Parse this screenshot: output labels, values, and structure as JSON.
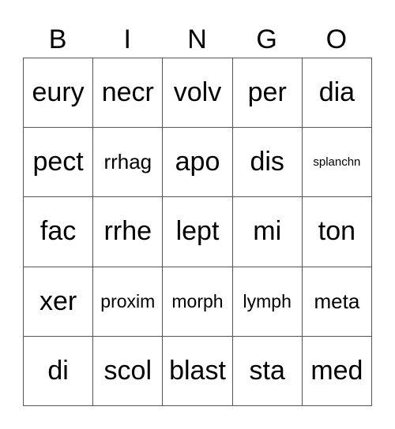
{
  "header": [
    "B",
    "I",
    "N",
    "G",
    "O"
  ],
  "board": [
    [
      "eury",
      "necr",
      "volv",
      "per",
      "dia"
    ],
    [
      "pect",
      "rrhag",
      "apo",
      "dis",
      "splanchn"
    ],
    [
      "fac",
      "rrhe",
      "lept",
      "mi",
      "ton"
    ],
    [
      "xer",
      "proxim",
      "morph",
      "lymph",
      "meta"
    ],
    [
      "di",
      "scol",
      "blast",
      "sta",
      "med"
    ]
  ]
}
